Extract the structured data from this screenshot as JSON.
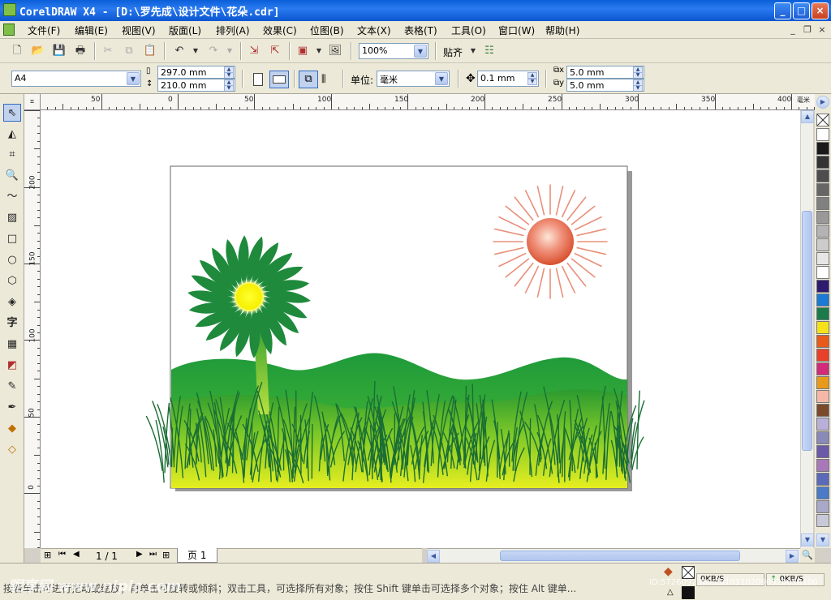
{
  "window": {
    "title": "CorelDRAW X4 - [D:\\罗先成\\设计文件\\花朵.cdr]",
    "minimize": "_",
    "maximize": "□",
    "close": "×"
  },
  "menu": {
    "items": [
      {
        "label": "文件(F)"
      },
      {
        "label": "编辑(E)"
      },
      {
        "label": "视图(V)"
      },
      {
        "label": "版面(L)"
      },
      {
        "label": "排列(A)"
      },
      {
        "label": "效果(C)"
      },
      {
        "label": "位图(B)"
      },
      {
        "label": "文本(X)"
      },
      {
        "label": "表格(T)"
      },
      {
        "label": "工具(O)"
      },
      {
        "label": "窗口(W)"
      },
      {
        "label": "帮助(H)"
      }
    ]
  },
  "toolbar": {
    "zoom_value": "100%",
    "snap_label": "贴齐"
  },
  "property_bar": {
    "page_size": "A4",
    "width": "297.0 mm",
    "height": "210.0 mm",
    "unit_label": "单位:",
    "unit_value": "毫米",
    "nudge": "0.1 mm",
    "dup_x": "5.0 mm",
    "dup_y": "5.0 mm"
  },
  "ruler": {
    "unit": "毫米",
    "top_labels": [
      "50",
      "0",
      "50",
      "100",
      "150",
      "200",
      "250",
      "300",
      "350",
      "400"
    ],
    "left_labels": [
      "200",
      "150",
      "100",
      "50",
      "0"
    ]
  },
  "page_nav": {
    "counter": "1 / 1",
    "tab": "页 1"
  },
  "status": {
    "hint": "接着单击可进行拖动或缩放；再单击可旋转或倾斜；双击工具，可选择所有对象；按住 Shift 键单击可选择多个对象；按住 Alt 键单...",
    "speed1": "0KB/S",
    "speed2": "0KB/S",
    "watermark_left": "昵享网 www.nipic.com",
    "watermark_right": "ID:5726092 NO:20101102090920058100"
  },
  "colors": {
    "accent": "#316ac5",
    "palette": [
      "#ffffff",
      "#1a1a1a",
      "#333333",
      "#4d4d4d",
      "#666666",
      "#808080",
      "#999999",
      "#b3b3b3",
      "#cccccc",
      "#e6e6e6",
      "#ffffff",
      "#2e1a6e",
      "#1a7ad4",
      "#1a7a4a",
      "#f5e21a",
      "#e85a1a",
      "#e8402a",
      "#d42a7a",
      "#e89a1a",
      "#f5b8a8",
      "#7a4a2a",
      "#b8b0d8",
      "#8a8ab8",
      "#6a5aa8",
      "#a878b8",
      "#5a6ab8",
      "#4a7ac8",
      "#a8a8c8",
      "#c8c8d8"
    ]
  }
}
